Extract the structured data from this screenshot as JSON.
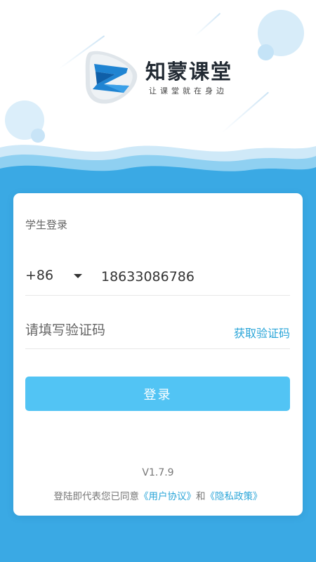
{
  "brand": {
    "name": "知蒙课堂",
    "slogan": "让课堂就在身边",
    "logo_icon": "z-letter-logo-icon"
  },
  "colors": {
    "accent": "#3aa9e4",
    "button": "#52c4f4",
    "link": "#2aa5d8"
  },
  "login": {
    "title": "学生登录",
    "country_code": "+86",
    "country_dropdown_icon": "caret-down-icon",
    "phone_value": "18633086786",
    "code_placeholder": "请填写验证码",
    "get_code_label": "获取验证码",
    "submit_label": "登录"
  },
  "footer": {
    "version": "V1.7.9",
    "agreement_prefix": "登陆即代表您已同意",
    "user_agreement": "《用户协议》",
    "connector": "和",
    "privacy_policy": "《隐私政策》"
  }
}
